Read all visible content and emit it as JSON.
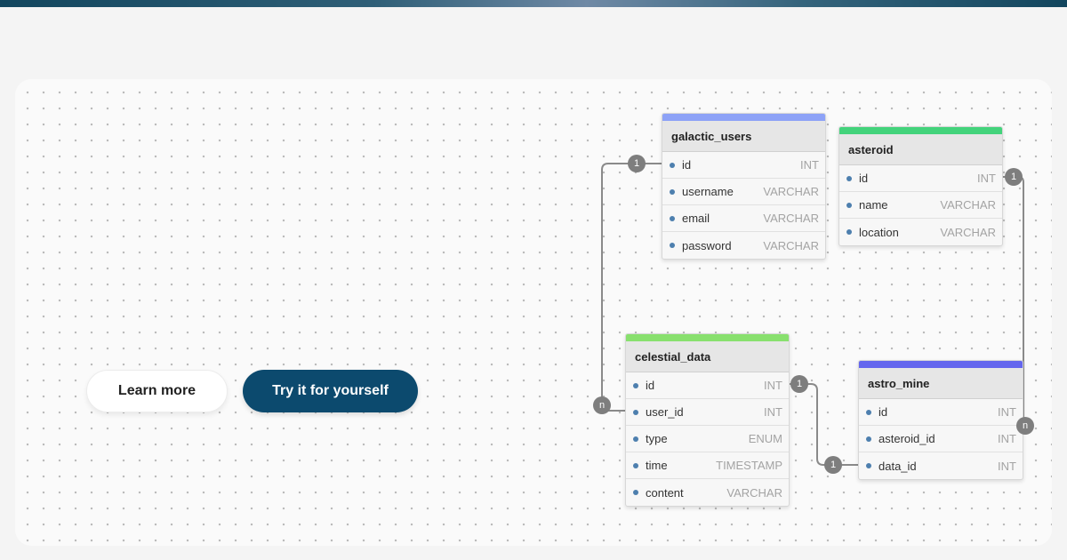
{
  "buttons": {
    "learn_more": "Learn more",
    "try_it": "Try it for yourself"
  },
  "tables": {
    "galactic_users": {
      "name": "galactic_users",
      "color": "#8da2f7",
      "fields": [
        {
          "name": "id",
          "type": "INT"
        },
        {
          "name": "username",
          "type": "VARCHAR"
        },
        {
          "name": "email",
          "type": "VARCHAR"
        },
        {
          "name": "password",
          "type": "VARCHAR"
        }
      ]
    },
    "asteroid": {
      "name": "asteroid",
      "color": "#43d37b",
      "fields": [
        {
          "name": "id",
          "type": "INT"
        },
        {
          "name": "name",
          "type": "VARCHAR"
        },
        {
          "name": "location",
          "type": "VARCHAR"
        }
      ]
    },
    "celestial_data": {
      "name": "celestial_data",
      "color": "#88e06e",
      "fields": [
        {
          "name": "id",
          "type": "INT"
        },
        {
          "name": "user_id",
          "type": "INT"
        },
        {
          "name": "type",
          "type": "ENUM"
        },
        {
          "name": "time",
          "type": "TIMESTAMP"
        },
        {
          "name": "content",
          "type": "VARCHAR"
        }
      ]
    },
    "astro_mine": {
      "name": "astro_mine",
      "color": "#6466ee",
      "fields": [
        {
          "name": "id",
          "type": "INT"
        },
        {
          "name": "asteroid_id",
          "type": "INT"
        },
        {
          "name": "data_id",
          "type": "INT"
        }
      ]
    }
  },
  "relations": [
    {
      "from": "galactic_users.id",
      "to": "celestial_data.user_id",
      "from_card": "1",
      "to_card": "n"
    },
    {
      "from": "asteroid.id",
      "to": "astro_mine.asteroid_id",
      "from_card": "1",
      "to_card": "n"
    },
    {
      "from": "celestial_data.id",
      "to": "astro_mine.data_id",
      "from_card": "1",
      "to_card": "1"
    }
  ]
}
